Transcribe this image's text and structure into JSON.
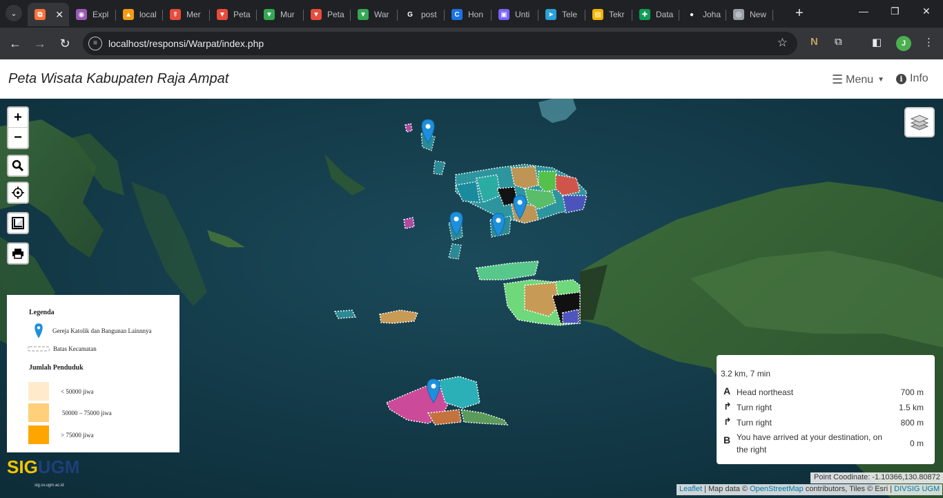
{
  "browser": {
    "tabs": [
      {
        "label": "",
        "color": "#ff7139",
        "glyph": "⧉"
      },
      {
        "label": "Expl",
        "color": "#9b59b6",
        "glyph": "◉"
      },
      {
        "label": "local",
        "color": "#f39c12",
        "glyph": "▲"
      },
      {
        "label": "Mer",
        "color": "#e74c3c",
        "glyph": "☤"
      },
      {
        "label": "Peta",
        "color": "#e74c3c",
        "glyph": "▼"
      },
      {
        "label": "Mur",
        "color": "#34a853",
        "glyph": "▼"
      },
      {
        "label": "Peta",
        "color": "#e74c3c",
        "glyph": "▼"
      },
      {
        "label": "War",
        "color": "#34a853",
        "glyph": "▼"
      },
      {
        "label": "post",
        "color": "#ffffff",
        "glyph": "G"
      },
      {
        "label": "Hon",
        "color": "#1a73e8",
        "glyph": "C"
      },
      {
        "label": "Unti",
        "color": "#7b61ff",
        "glyph": "▣"
      },
      {
        "label": "Tele",
        "color": "#2aa1da",
        "glyph": "➤"
      },
      {
        "label": "Tekr",
        "color": "#f4b400",
        "glyph": "▤"
      },
      {
        "label": "Data",
        "color": "#0f9d58",
        "glyph": "✚"
      },
      {
        "label": "Joha",
        "color": "#ffffff",
        "glyph": "●"
      },
      {
        "label": "New",
        "color": "#9aa0a6",
        "glyph": "◎"
      }
    ],
    "url": "localhost/responsi/Warpat/index.php",
    "profile_initial": "J"
  },
  "navbar": {
    "brand": "Peta Wisata Kabupaten Raja Ampat",
    "menu_label": "Menu",
    "info_label": "Info"
  },
  "map": {
    "zoom_in": "+",
    "zoom_out": "−",
    "legend": {
      "title": "Legenda",
      "marker_label": "Gereja Katolik dan Bangunan Lainnnya",
      "boundary_label": "Batas Kecamatan",
      "population_title": "Jumlah Penduduk",
      "classes": [
        {
          "label": "< 50000 jiwa",
          "color": "#ffebcc"
        },
        {
          "label": "50000 – 75000 jiwa",
          "color": "#ffd07a"
        },
        {
          "label": "> 75000 jiwa",
          "color": "#ffa500"
        }
      ]
    },
    "logo": {
      "part1": "SIG",
      "part2": "UGM",
      "sub": "sig.sv.ugm.ac.id"
    },
    "routing": {
      "summary": "3.2 km, 7 min",
      "steps": [
        {
          "icon": "A",
          "text": "Head northeast",
          "distance": "700 m"
        },
        {
          "icon": "↱",
          "text": "Turn right",
          "distance": "1.5 km"
        },
        {
          "icon": "↱",
          "text": "Turn right",
          "distance": "800 m"
        },
        {
          "icon": "B",
          "text": "You have arrived at your destination, on the right",
          "distance": "0 m"
        }
      ]
    },
    "coordinate_label": "Point Coodinate: -1.10366,130.80872",
    "attribution": {
      "leaflet": "Leaflet",
      "sep1": " | Map data © ",
      "osm": "OpenStreetMap",
      "mid": " contributors, Tiles © Esri | ",
      "divsig": "DIVSIG UGM"
    }
  }
}
